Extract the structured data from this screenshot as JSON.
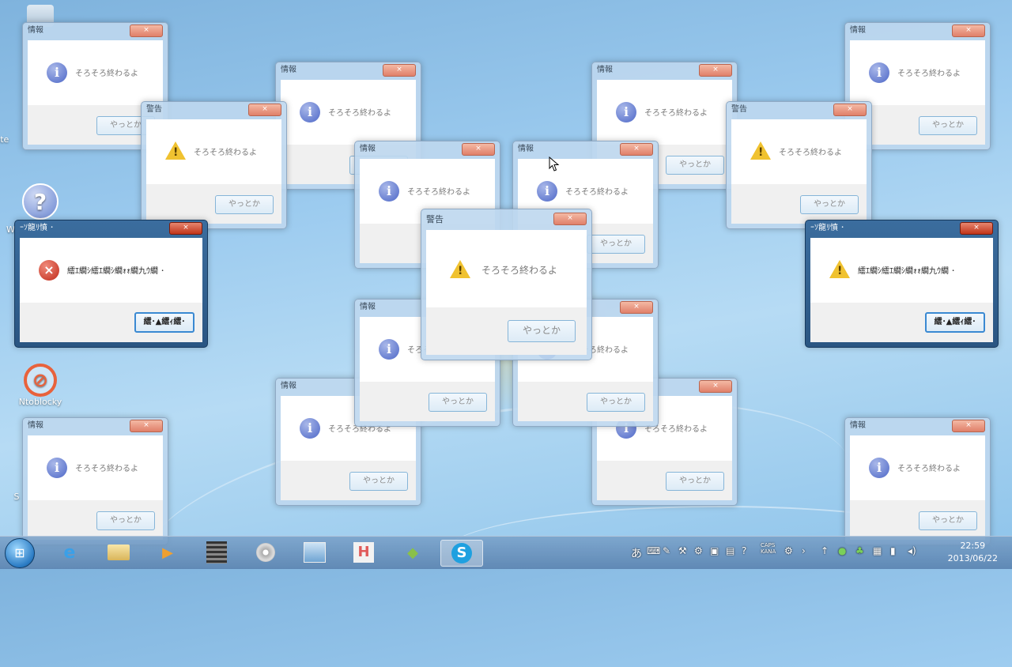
{
  "desktop": {
    "icons": [
      {
        "label": "Inte",
        "name": "internet-icon"
      },
      {
        "label": "W",
        "name": "help-icon"
      },
      {
        "label": "Ntoblocky",
        "name": "block-icon"
      },
      {
        "label": "S",
        "name": "shortcut-icon"
      }
    ]
  },
  "dialogs": {
    "info_title": "情報",
    "warn_title": "警告",
    "message": "そろそろ終わるよ",
    "button_label": "やっとか",
    "dark_title": "ｰｿ龍ﾘ憤 ･",
    "dark_message": "繧ｴ繝ｼ繧ｴ繝ｼ繝ｫｫ繝九ｳ繝 ･",
    "dark_button_label": "繧･▲繧ｨ繧･"
  },
  "taskbar": {
    "clock_time": "22:59",
    "clock_date": "2013/06/22",
    "ime": "あ",
    "tray_caps": "CAPS KANA"
  },
  "colors": {
    "accent": "#3a89d2",
    "warning": "#f0c230",
    "error": "#c02a1a",
    "info": "#4d67c7"
  }
}
